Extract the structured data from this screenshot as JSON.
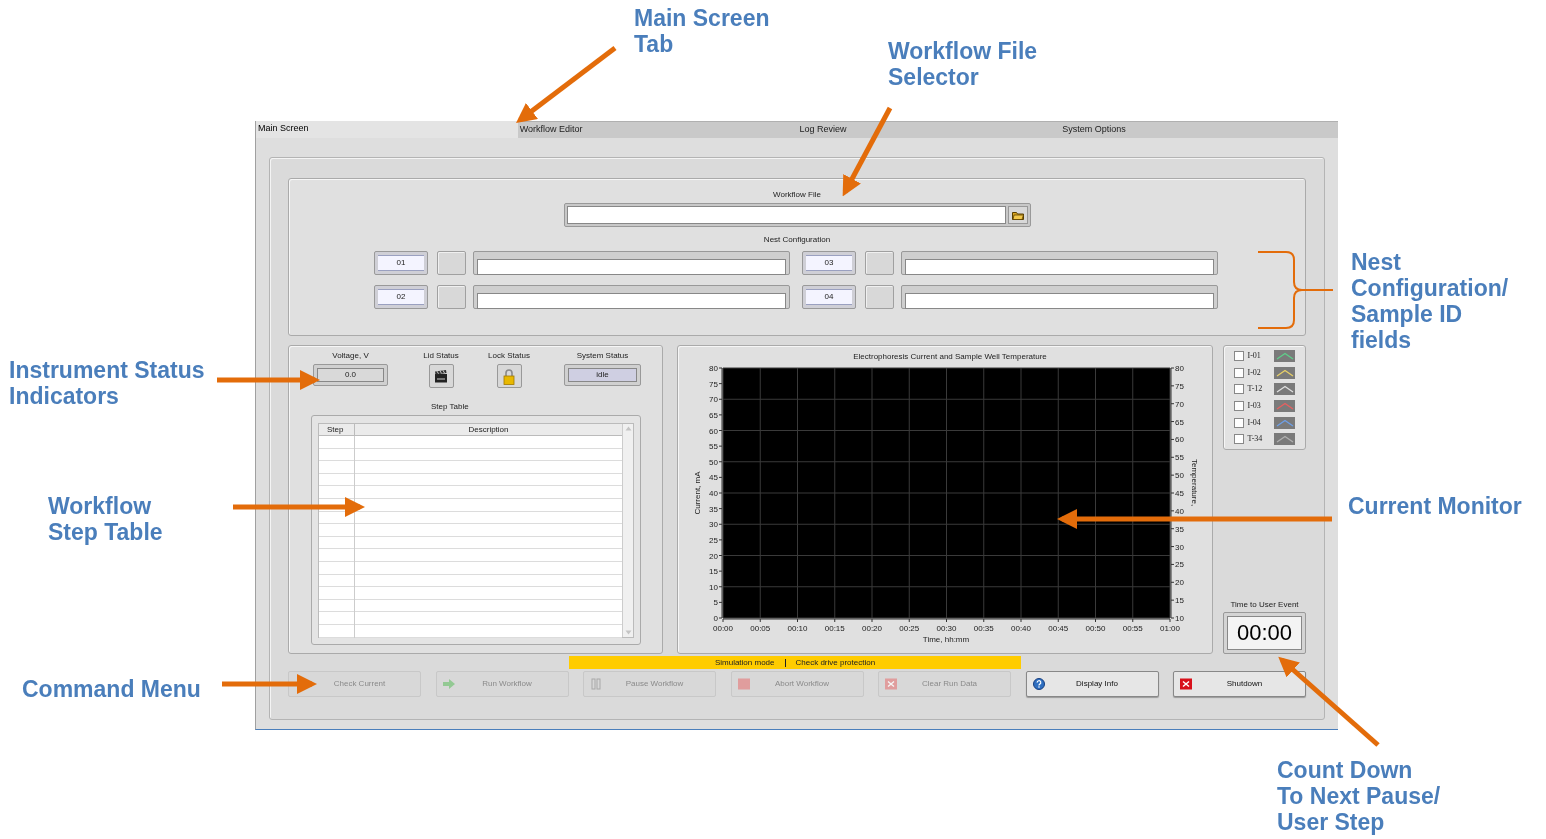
{
  "annotations": [
    {
      "text": "Main Screen\nTab"
    },
    {
      "text": "Workflow File\nSelector"
    },
    {
      "text": "Nest\nConfiguration/\nSample ID\nfields"
    },
    {
      "text": "Instrument Status\nIndicators"
    },
    {
      "text": "Workflow\nStep Table"
    },
    {
      "text": "Current Monitor"
    },
    {
      "text": "Command Menu"
    },
    {
      "text": "Count Down\nTo Next Pause/\nUser Step"
    }
  ],
  "tabs": [
    {
      "label": "Main Screen",
      "selected": true
    },
    {
      "label": "Workflow Editor",
      "selected": false
    },
    {
      "label": "Log Review",
      "selected": false
    },
    {
      "label": "System Options",
      "selected": false
    }
  ],
  "workflow_file": {
    "label": "Workflow File"
  },
  "nest_configuration": {
    "label": "Nest Configuration",
    "nests": [
      {
        "number": "01"
      },
      {
        "number": "03"
      },
      {
        "number": "02"
      },
      {
        "number": "04"
      }
    ]
  },
  "indicators": {
    "voltage_label": "Voltage, V",
    "voltage": "0.0",
    "lid_label": "Lid Status",
    "lock_label": "Lock Status",
    "system_label": "System Status",
    "system_status": "idle"
  },
  "step_table": {
    "title": "Step Table",
    "columns": [
      "Step",
      "Description"
    ]
  },
  "chart": {
    "chart_data": {
      "type": "line",
      "grid": true,
      "title": "Electrophoresis Current and Sample Well Temperature",
      "xlabel": "Time, hh:mm",
      "ylabel": "Current, mA",
      "xlim": [
        0,
        60
      ],
      "ylim": [
        0,
        80
      ],
      "xticks": [
        {
          "value": 0,
          "label": "00:00"
        },
        {
          "value": 5,
          "label": "00:05"
        },
        {
          "value": 10,
          "label": "00:10"
        },
        {
          "value": 15,
          "label": "00:15"
        },
        {
          "value": 20,
          "label": "00:20"
        },
        {
          "value": 25,
          "label": "00:25"
        },
        {
          "value": 30,
          "label": "00:30"
        },
        {
          "value": 35,
          "label": "00:35"
        },
        {
          "value": 40,
          "label": "00:40"
        },
        {
          "value": 45,
          "label": "00:45"
        },
        {
          "value": 50,
          "label": "00:50"
        },
        {
          "value": 55,
          "label": "00:55"
        },
        {
          "value": 60,
          "label": "01:00"
        }
      ],
      "yticks": [
        0,
        5,
        10,
        15,
        20,
        25,
        30,
        35,
        40,
        45,
        50,
        55,
        60,
        65,
        70,
        75,
        80
      ],
      "y2label": "Temperature,",
      "y2lim": [
        10,
        80
      ],
      "y2ticks": [
        10,
        15,
        20,
        25,
        30,
        35,
        40,
        45,
        50,
        55,
        60,
        65,
        70,
        75,
        80
      ]
    }
  },
  "legend": [
    {
      "label": "I-01",
      "checked": false,
      "color": "#5fcf8a"
    },
    {
      "label": "I-02",
      "checked": false,
      "color": "#e8d068"
    },
    {
      "label": "T-12",
      "checked": false,
      "color": "#e0e0e0"
    },
    {
      "label": "I-03",
      "checked": false,
      "color": "#e86060"
    },
    {
      "label": "I-04",
      "checked": false,
      "color": "#6fa0e8"
    },
    {
      "label": "T-34",
      "checked": false,
      "color": "#b0b0b0"
    }
  ],
  "countdown": {
    "label": "Time to User Event",
    "value": "00:00"
  },
  "status_messages": [
    "Simulation mode",
    "Check drive protection"
  ],
  "commands": [
    {
      "label": "Check Current",
      "kind": "plain",
      "disabled": true
    },
    {
      "label": "Run Workflow",
      "kind": "run",
      "disabled": true
    },
    {
      "label": "Pause Workflow",
      "kind": "pause",
      "disabled": true
    },
    {
      "label": "Abort Workflow",
      "kind": "abort",
      "disabled": true
    },
    {
      "label": "Clear Run Data",
      "kind": "clear",
      "disabled": true
    },
    {
      "label": "Display Info",
      "kind": "info",
      "disabled": false
    },
    {
      "label": "Shutdown",
      "kind": "shutdown",
      "disabled": false
    }
  ]
}
